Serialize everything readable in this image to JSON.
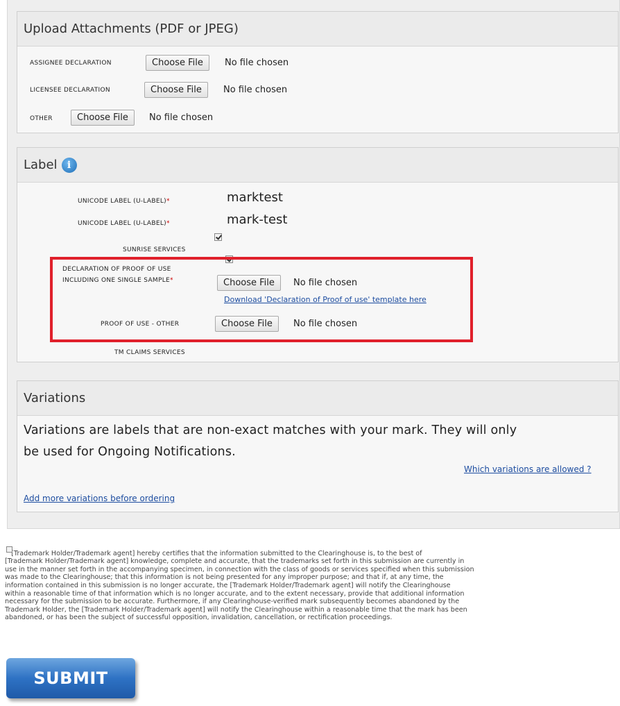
{
  "upload": {
    "title": "Upload Attachments (PDF or JPEG)",
    "rows": [
      {
        "label": "ASSIGNEE DECLARATION",
        "button": "Choose File",
        "status": "No file chosen"
      },
      {
        "label": "LICENSEE DECLARATION",
        "button": "Choose File",
        "status": "No file chosen"
      },
      {
        "label": "OTHER",
        "button": "Choose File",
        "status": "No file chosen"
      }
    ]
  },
  "label_section": {
    "title": "Label",
    "info_icon": "info-icon",
    "u_label_1": {
      "label": "UNICODE LABEL (U-LABEL)",
      "req": "*",
      "value": "marktest",
      "checked": true
    },
    "u_label_2": {
      "label": "UNICODE LABEL (U-LABEL)",
      "req": "*",
      "value": "mark-test",
      "checked": true
    },
    "sunrise": {
      "label": "SUNRISE SERVICES",
      "checked": true
    },
    "proof_decl": {
      "label_line1": "DECLARATION OF PROOF OF USE",
      "label_line2": "INCLUDING ONE SINGLE SAMPLE",
      "req": "*",
      "button": "Choose File",
      "status": "No file chosen",
      "template_link": "Download 'Declaration of Proof of use' template here"
    },
    "proof_other": {
      "label": "PROOF OF USE - OTHER",
      "button": "Choose File",
      "status": "No file chosen"
    },
    "tm_claims": {
      "label": "TM CLAIMS SERVICES",
      "checked": true
    },
    "highlight_color": "#e0202b"
  },
  "variations": {
    "title": "Variations",
    "text_line1": "Variations are labels that are non-exact matches with your mark. They will only",
    "text_line2": "be used for Ongoing Notifications.",
    "allowed_link": "Which variations are allowed ?",
    "add_link": "Add more variations before ordering"
  },
  "declaration": {
    "checked": false,
    "lines": [
      "   [Trademark Holder/Trademark agent] hereby certifies that the information submitted to the Clearinghouse is, to the best of",
      "[Trademark Holder/Trademark agent] knowledge, complete and accurate, that the trademarks set forth in this submission are currently in",
      "use in the manner set forth in the accompanying specimen, in connection with the class of goods or services specified when this submission",
      "was made to the Clearinghouse; that this information is not being presented for any improper purpose; and that if, at any time, the",
      "information contained in this submission is no longer accurate, the [Trademark Holder/Trademark agent] will notify the Clearinghouse",
      "within a reasonable time of that information which is no longer accurate, and to the extent necessary, provide that additional information",
      "necessary for the submission to be accurate. Furthermore, if any Clearinghouse-verified mark subsequently becomes abandoned by the",
      "Trademark Holder, the [Trademark Holder/Trademark agent] will notify the Clearinghouse within a reasonable time that the mark has been",
      "abandoned, or has been the subject of successful opposition, invalidation, cancellation, or rectification proceedings."
    ]
  },
  "submit": {
    "label": "SUBMIT",
    "color": "#2e72c4"
  }
}
